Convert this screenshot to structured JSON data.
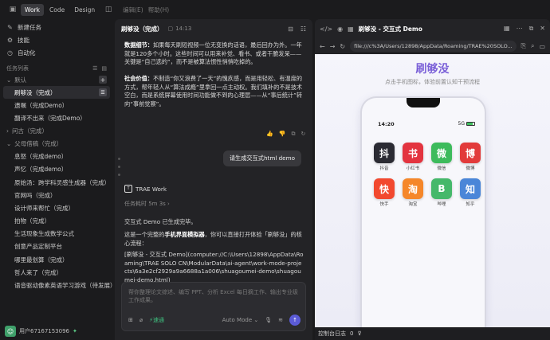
{
  "topbar": {
    "modes": [
      {
        "label": "Work",
        "active": true
      },
      {
        "label": "Code",
        "active": false
      },
      {
        "label": "Design",
        "active": false
      }
    ],
    "menus": [
      "编辑(E)",
      "帮助(H)"
    ]
  },
  "sidebar": {
    "top_items": [
      {
        "icon": "new-task-icon",
        "label": "新建任务"
      },
      {
        "icon": "skills-icon",
        "label": "技能"
      },
      {
        "icon": "automation-icon",
        "label": "自动化"
      }
    ],
    "section_title": "任务列表",
    "groups": [
      {
        "name": "默认",
        "expanded": true,
        "tasks": [
          {
            "label": "刷够没（完成）",
            "active": true
          },
          {
            "label": "遗嘱（完成Demo）",
            "active": false
          },
          {
            "label": "翻译不出来（完成Demo）",
            "active": false
          }
        ]
      },
      {
        "name": "问古（完成）",
        "expanded": false,
        "tasks": []
      },
      {
        "name": "父母借稿（完成）",
        "expanded": true,
        "tasks": [
          {
            "label": "息怒（完成demo）",
            "active": false
          },
          {
            "label": "声忆（完成demo）",
            "active": false
          },
          {
            "label": "原始汤：跨学科灵感生成器（完成）",
            "active": false
          },
          {
            "label": "官网吗（完成）",
            "active": false
          },
          {
            "label": "设计师来帮忙（完成）",
            "active": false
          },
          {
            "label": "拍物（完成）",
            "active": false
          },
          {
            "label": "生活现象生成数学公式",
            "active": false
          },
          {
            "label": "创意产品定制平台",
            "active": false
          },
          {
            "label": "哪里最划算（完成）",
            "active": false
          },
          {
            "label": "哲人来了（完成）",
            "active": false
          },
          {
            "label": "语音驱动像素英语学习游戏（待发展）",
            "active": false
          }
        ]
      }
    ],
    "user": {
      "name": "用户67167153096"
    }
  },
  "chat": {
    "title": "刷够没（完成）",
    "time": "14:13",
    "top_paragraph_lead": "数据细节：",
    "top_paragraph": "如果每天刷短视频一位无变换的话语，最后回办为外。一年就是120多个小时。这些时间可以用来补觉、看书、或者干脆发呆——关键是“自己选的”，而不是被算法惯性悄悄吃掉的。",
    "social_lead": "社会价值：",
    "social_text": "不制造“你又浪费了一天”的愧疚感，而是用轻松、有温度的方式，帮年轻人从“算法成瘾”里拿回一点主动权。我们填补的不是技术空白，而是系统屏幕使用时间功能做不到的心理层——从“事后统计”转向“事前觉察”。",
    "user_message": "请生成交互式html demo",
    "agent_name": "TRAE Work",
    "elapsed": "任务耗时 5m 3s",
    "reply_1": "交互式 Demo 已生成完毕。",
    "reply_2_pre": "这是一个完整的",
    "reply_2_bold": "手机界面模拟器",
    "reply_2_post": "，你可以直接打开体验「刷够没」的核心流程：",
    "reply_3": "[刷够没 - 交互式 Demo](computer://C:\\Users\\12898\\AppData\\Roaming\\TRAE SOLO CN\\ModularData\\ai-agent\\work-mode-projects\\6a3e2cf2929a9a6688a1a006\\shuagoumei-demo\\shuagoumei-demo.html)",
    "input_placeholder": "帮你整理论文综述、编写 PPT、分析 Excel 每日摘工作、输出专业级工作成果。",
    "fast_label": "速通",
    "mode_label": "Auto Mode"
  },
  "browser": {
    "title": "刷够没 - 交互式 Demo",
    "url": "file:///c%3A/Users/12898/AppData/Roaming/TRAE%20SOLO...",
    "page_title": "刷够没",
    "page_subtitle": "点击手机图标，体验前置认知干预流程",
    "status_time": "14:20",
    "network": "5G",
    "battery_level": 0.8,
    "apps": [
      {
        "glyph": "抖",
        "name": "抖音",
        "color": "#2b2b33"
      },
      {
        "glyph": "书",
        "name": "小红书",
        "color": "#e3343f"
      },
      {
        "glyph": "微",
        "name": "微信",
        "color": "#3dbb5c"
      },
      {
        "glyph": "博",
        "name": "微博",
        "color": "#e23b3b"
      },
      {
        "glyph": "快",
        "name": "快手",
        "color": "#f2492f"
      },
      {
        "glyph": "淘",
        "name": "淘宝",
        "color": "#f5872a"
      },
      {
        "glyph": "B",
        "name": "哔哩",
        "color": "#45b86a"
      },
      {
        "glyph": "知",
        "name": "知乎",
        "color": "#4a86d8"
      }
    ],
    "console_label": "控制台日志",
    "console_count": "0"
  }
}
